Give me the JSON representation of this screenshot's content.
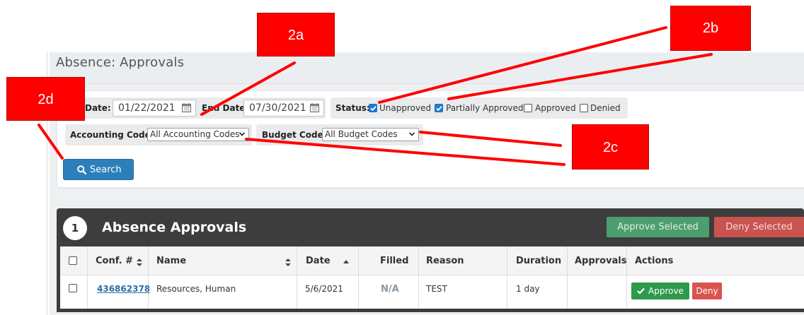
{
  "page": {
    "title": "Absence: Approvals"
  },
  "filters": {
    "start_date_label": "Date:",
    "start_date_value": "01/22/2021",
    "end_date_label": "End Date:",
    "end_date_value": "07/30/2021",
    "status_label": "Status:",
    "statuses": [
      {
        "label": "Unapproved",
        "checked": true
      },
      {
        "label": "Partially Approved",
        "checked": true
      },
      {
        "label": "Approved",
        "checked": false
      },
      {
        "label": "Denied",
        "checked": false
      }
    ],
    "accounting_code_label": "Accounting Code:",
    "accounting_code_value": "All Accounting Codes",
    "budget_code_label": "Budget Code:",
    "budget_code_value": "All Budget Codes",
    "search_label": "Search"
  },
  "grid": {
    "count": "1",
    "title": "Absence Approvals",
    "approve_selected_label": "Approve Selected",
    "deny_selected_label": "Deny Selected",
    "columns": [
      "Conf. #",
      "Name",
      "Date",
      "Filled",
      "Reason",
      "Duration",
      "Approvals",
      "Actions"
    ],
    "rows": [
      {
        "conf": "436862378",
        "name": "Resources, Human",
        "date": "5/6/2021",
        "filled": "N/A",
        "reason": "TEST",
        "duration": "1 day",
        "approvals": "",
        "approve_label": "Approve",
        "deny_label": "Deny"
      }
    ]
  },
  "callouts": {
    "a": "2a",
    "b": "2b",
    "c": "2c",
    "d": "2d"
  },
  "colors": {
    "accent_blue": "#2c7fba",
    "approve_green": "#2e9a4c",
    "deny_red": "#d9534f",
    "callout_red": "#ff0000",
    "grid_header": "#3d3d3d"
  },
  "icons": [
    "calendar-icon",
    "chevron-down-icon",
    "search-icon",
    "check-icon",
    "sort-icon"
  ]
}
